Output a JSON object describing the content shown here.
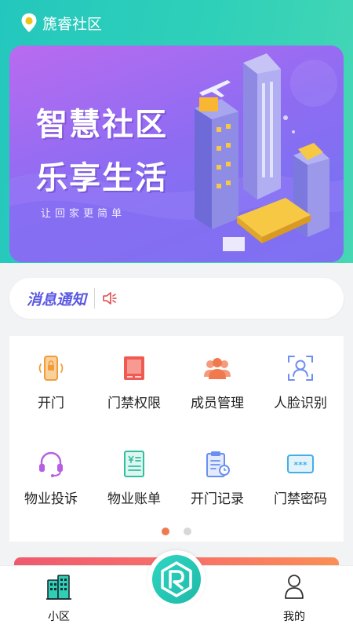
{
  "header": {
    "title": "篪睿社区",
    "icon": "location-pin-icon"
  },
  "banner": {
    "line1": "智慧社区",
    "line2": "乐享生活",
    "tagline": "让回家更简单"
  },
  "notice": {
    "label": "消息通知",
    "icon": "speaker-icon"
  },
  "features": [
    {
      "label": "开门",
      "icon": "phone-unlock-icon",
      "color": "#f39b3b"
    },
    {
      "label": "门禁权限",
      "icon": "access-card-icon",
      "color": "#ef5b52"
    },
    {
      "label": "成员管理",
      "icon": "members-icon",
      "color": "#f07a4e"
    },
    {
      "label": "人脸识别",
      "icon": "face-id-icon",
      "color": "#6f8ef2"
    },
    {
      "label": "物业投诉",
      "icon": "headset-icon",
      "color": "#b65fe0"
    },
    {
      "label": "物业账单",
      "icon": "bill-icon",
      "color": "#2fbfa1"
    },
    {
      "label": "开门记录",
      "icon": "record-clipboard-icon",
      "color": "#6a8ff0"
    },
    {
      "label": "门禁密码",
      "icon": "password-icon",
      "color": "#44aee6"
    }
  ],
  "pager": {
    "active_color": "#f07a4e",
    "inactive_color": "#d8d8d8"
  },
  "tabbar": {
    "items": [
      {
        "label": "小区",
        "icon": "community-buildings-icon"
      },
      {
        "label": "我的",
        "icon": "user-icon"
      }
    ],
    "center_icon": "brand-logo-icon"
  }
}
